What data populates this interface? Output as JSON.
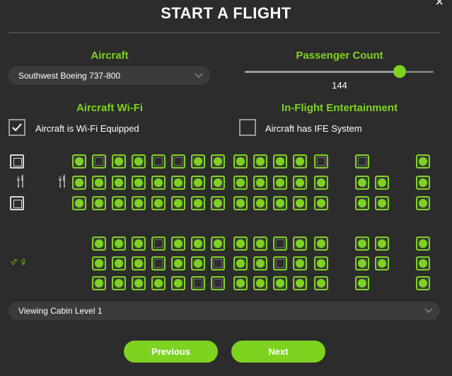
{
  "title": "START A FLIGHT",
  "close_label": "×",
  "aircraft": {
    "label": "Aircraft",
    "selected": "Southwest Boeing 737-800"
  },
  "passenger": {
    "label": "Passenger Count",
    "value": "144",
    "fraction": 0.82
  },
  "wifi": {
    "label": "Aircraft Wi-Fi",
    "checkbox_label": "Aircraft is Wi-Fi Equipped",
    "checked": true
  },
  "ife": {
    "label": "In-Flight Entertainment",
    "checkbox_label": "Aircraft has IFE System",
    "checked": false
  },
  "cabin": {
    "selected": "Viewing Cabin Level 1"
  },
  "buttons": {
    "previous": "Previous",
    "next": "Next"
  },
  "colors": {
    "accent": "#7ed321",
    "background": "#2c2c2c"
  },
  "icons": {
    "galley": "fork-knife-icon",
    "lavatory": "restroom-icon",
    "seat": "seat-icon"
  }
}
